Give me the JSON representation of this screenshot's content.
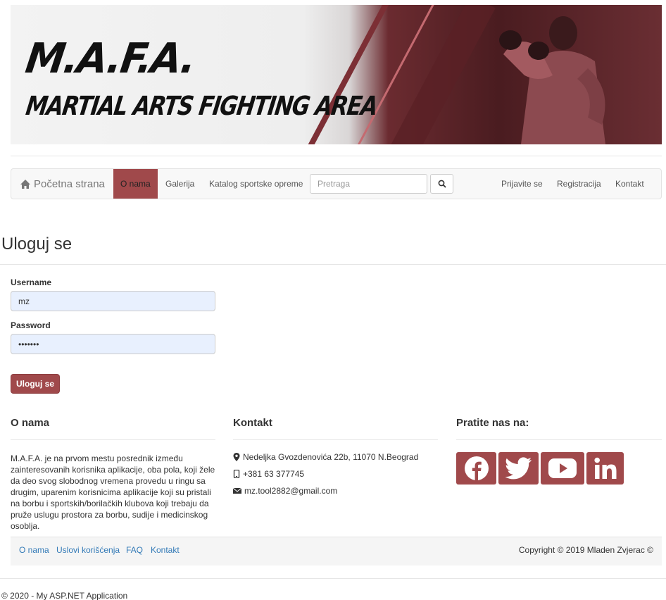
{
  "banner": {
    "title": "M.A.F.A.",
    "subtitle": "MARTIAL ARTS FIGHTING AREA"
  },
  "navbar": {
    "brand": "Početna strana",
    "items": [
      {
        "label": "O nama",
        "active": true
      },
      {
        "label": "Galerija"
      },
      {
        "label": "Katalog sportske opreme"
      }
    ],
    "search_placeholder": "Pretraga",
    "right_items": [
      {
        "label": "Prijavite se"
      },
      {
        "label": "Registracija"
      },
      {
        "label": "Kontakt"
      }
    ]
  },
  "login": {
    "heading": "Uloguj se",
    "username_label": "Username",
    "username_value": "mz",
    "password_label": "Password",
    "password_value": "•••••••",
    "submit_label": "Uloguj se"
  },
  "footer": {
    "about": {
      "title": "O nama",
      "text": "M.A.F.A. je na prvom mestu posrednik između zainteresovanih korisnika aplikacije, oba pola, koji žele da deo svog slobodnog vremena provedu u ringu sa drugim, uparenim korisnicima aplikacije koji su pristali na borbu i sportskih/borilačkih klubova koji trebaju da pruže uslugu prostora za borbu, sudije i medicinskog osoblja."
    },
    "contact": {
      "title": "Kontakt",
      "address": "Nedeljka Gvozdenovića 22b, 11070 N.Beograd",
      "phone": "+381 63 377745",
      "email": "mz.tool2882@gmail.com"
    },
    "follow": {
      "title": "Pratite nas na:",
      "networks": [
        "facebook-icon",
        "twitter-icon",
        "youtube-icon",
        "linkedin-icon"
      ]
    },
    "links": [
      {
        "label": "O nama"
      },
      {
        "label": "Uslovi korišćenja"
      },
      {
        "label": "FAQ"
      },
      {
        "label": "Kontakt"
      }
    ],
    "copyright": "Copyright © 2019 Mladen Zvjerac ©"
  },
  "app_footer": "© 2020 - My ASP.NET Application",
  "colors": {
    "accent": "#a0494b",
    "link": "#337ab7"
  }
}
